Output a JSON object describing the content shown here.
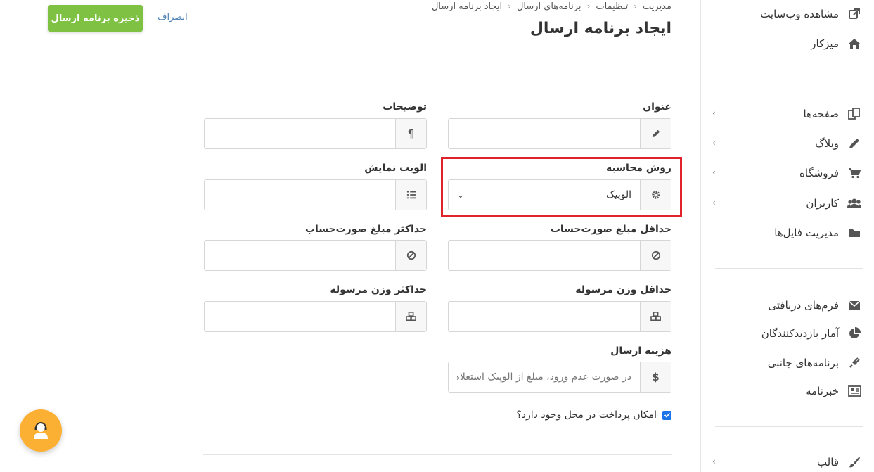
{
  "sidebar": {
    "items": [
      {
        "label": "مشاهده وب‌سایت",
        "icon": "external-link-icon"
      },
      {
        "label": "میزکار",
        "icon": "home-icon"
      },
      {
        "label": "صفحه‌ها",
        "icon": "pages-icon"
      },
      {
        "label": "وبلاگ",
        "icon": "pencil-icon"
      },
      {
        "label": "فروشگاه",
        "icon": "cart-icon"
      },
      {
        "label": "کاربران",
        "icon": "users-icon"
      },
      {
        "label": "مدیریت فایل‌ها",
        "icon": "folder-icon"
      },
      {
        "label": "فرم‌های دریافتی",
        "icon": "envelope-icon"
      },
      {
        "label": "آمار بازدیدکنندگان",
        "icon": "pie-chart-icon"
      },
      {
        "label": "برنامه‌های جانبی",
        "icon": "plug-icon"
      },
      {
        "label": "خبرنامه",
        "icon": "newspaper-icon"
      },
      {
        "label": "قالب",
        "icon": "brush-icon"
      }
    ]
  },
  "breadcrumb": [
    "مدیریت",
    "تنظیمات",
    "برنامه‌های ارسال",
    "ایجاد برنامه ارسال"
  ],
  "page_title": "ایجاد برنامه ارسال",
  "toolbar": {
    "save_label": "ذخیره برنامه ارسال",
    "cancel_label": "انصراف"
  },
  "form": {
    "title_label": "عنوان",
    "title_value": "",
    "description_label": "توضیحات",
    "description_value": "",
    "calc_method_label": "روش محاسبه",
    "calc_method_value": "الوپیک",
    "priority_label": "الویت نمایش",
    "priority_value": "",
    "min_invoice_label": "حداقل مبلغ صورت‌حساب",
    "max_invoice_label": "حداکثر مبلغ صورت‌حساب",
    "min_weight_label": "حداقل وزن مرسوله",
    "max_weight_label": "حداکثر وزن مرسوله",
    "cost_label": "هزینه ارسال",
    "cost_placeholder": "در صورت عدم ورود، مبلغ از الوپیک استعلام",
    "cod_label": "امکان پرداخت در محل وجود دارد؟",
    "cod_checked": true
  },
  "colors": {
    "accent_green": "#7fc243",
    "highlight_red": "#e0222a",
    "support_orange": "#fbb034"
  }
}
